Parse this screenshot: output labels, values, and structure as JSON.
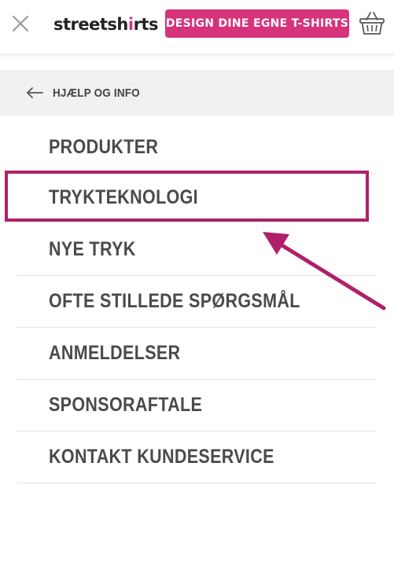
{
  "header": {
    "logo_prefix": "streetsh",
    "logo_i": "i",
    "logo_suffix": "rts",
    "design_button_label": "DESIGN DINE EGNE T-SHIRTS",
    "icons": {
      "close": "close-icon",
      "cart": "basket-icon"
    }
  },
  "subheader": {
    "back_label": "HJÆLP OG INFO",
    "icon": "arrow-left-icon"
  },
  "menu": {
    "items": [
      {
        "label": "PRODUKTER"
      },
      {
        "label": "TRYKTEKNOLOGI"
      },
      {
        "label": "NYE TRYK"
      },
      {
        "label": "OFTE STILLEDE SPØRGSMÅL"
      },
      {
        "label": "ANMELDELSER"
      },
      {
        "label": "SPONSORAFTALE"
      },
      {
        "label": "KONTAKT KUNDESERVICE"
      }
    ]
  },
  "annotation": {
    "highlighted_item": "TRYKTEKNOLOGI",
    "color": "#b0206a"
  },
  "colors": {
    "brand_pink": "#d6337a",
    "text_dark": "#4a4a4a",
    "subheader_bg": "#f1f1f1"
  }
}
